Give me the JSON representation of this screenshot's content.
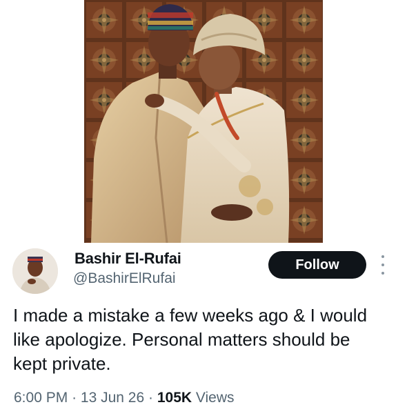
{
  "user": {
    "display_name": "Bashir El-Rufai",
    "handle": "@BashirElRufai",
    "avatar_icon": "profile-photo"
  },
  "follow_button": {
    "label": "Follow"
  },
  "more_icon": "more-vertical-icon",
  "tweet": {
    "text": "I made a mistake a few weeks ago & I would like apologize. Personal matters should be kept private.",
    "time": "6:00 PM",
    "separator": "·",
    "date": "13 Jun 26",
    "views_count": "105K",
    "views_label": "Views"
  },
  "image": {
    "subject": "couple-wedding-photo"
  },
  "colors": {
    "primary_text": "#0f1419",
    "secondary_text": "#536471",
    "button_bg": "#0f1419",
    "button_text": "#ffffff"
  }
}
